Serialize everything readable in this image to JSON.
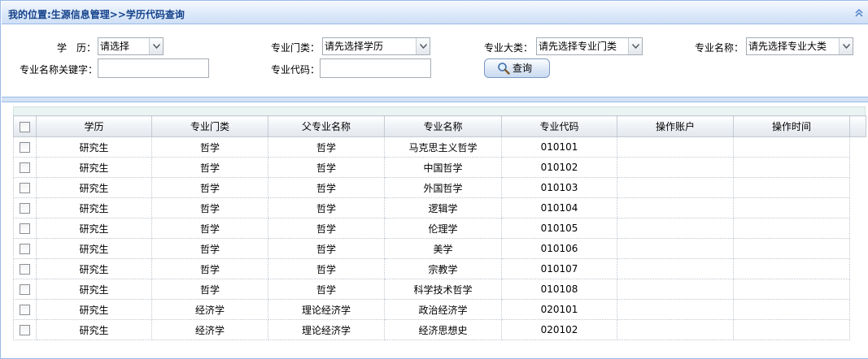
{
  "breadcrumb": "我的位置:生源信息管理>>学历代码查询",
  "search": {
    "education_label": "学　历：",
    "education_value": "请选择",
    "category_label": "专业门类：",
    "category_value": "请先选择学历",
    "major_class_label": "专业大类：",
    "major_class_value": "请先选择专业门类",
    "major_name_label": "专业名称：",
    "major_name_value": "请先选择专业大类",
    "keyword_label": "专业名称关键字：",
    "keyword_value": "",
    "code_label": "专业代码：",
    "code_value": "",
    "query_button": "查询"
  },
  "grid": {
    "columns": [
      "学历",
      "专业门类",
      "父专业名称",
      "专业名称",
      "专业代码",
      "操作账户",
      "操作时间"
    ],
    "rows": [
      [
        "研究生",
        "哲学",
        "哲学",
        "马克思主义哲学",
        "010101",
        "",
        ""
      ],
      [
        "研究生",
        "哲学",
        "哲学",
        "中国哲学",
        "010102",
        "",
        ""
      ],
      [
        "研究生",
        "哲学",
        "哲学",
        "外国哲学",
        "010103",
        "",
        ""
      ],
      [
        "研究生",
        "哲学",
        "哲学",
        "逻辑学",
        "010104",
        "",
        ""
      ],
      [
        "研究生",
        "哲学",
        "哲学",
        "伦理学",
        "010105",
        "",
        ""
      ],
      [
        "研究生",
        "哲学",
        "哲学",
        "美学",
        "010106",
        "",
        ""
      ],
      [
        "研究生",
        "哲学",
        "哲学",
        "宗教学",
        "010107",
        "",
        ""
      ],
      [
        "研究生",
        "哲学",
        "哲学",
        "科学技术哲学",
        "010108",
        "",
        ""
      ],
      [
        "研究生",
        "经济学",
        "理论经济学",
        "政治经济学",
        "020101",
        "",
        ""
      ],
      [
        "研究生",
        "经济学",
        "理论经济学",
        "经济思想史",
        "020102",
        "",
        ""
      ]
    ]
  },
  "colors": {
    "title_text": "#15428b",
    "panel_border": "#99bbe8",
    "header_bg": "#dbe8f9"
  }
}
